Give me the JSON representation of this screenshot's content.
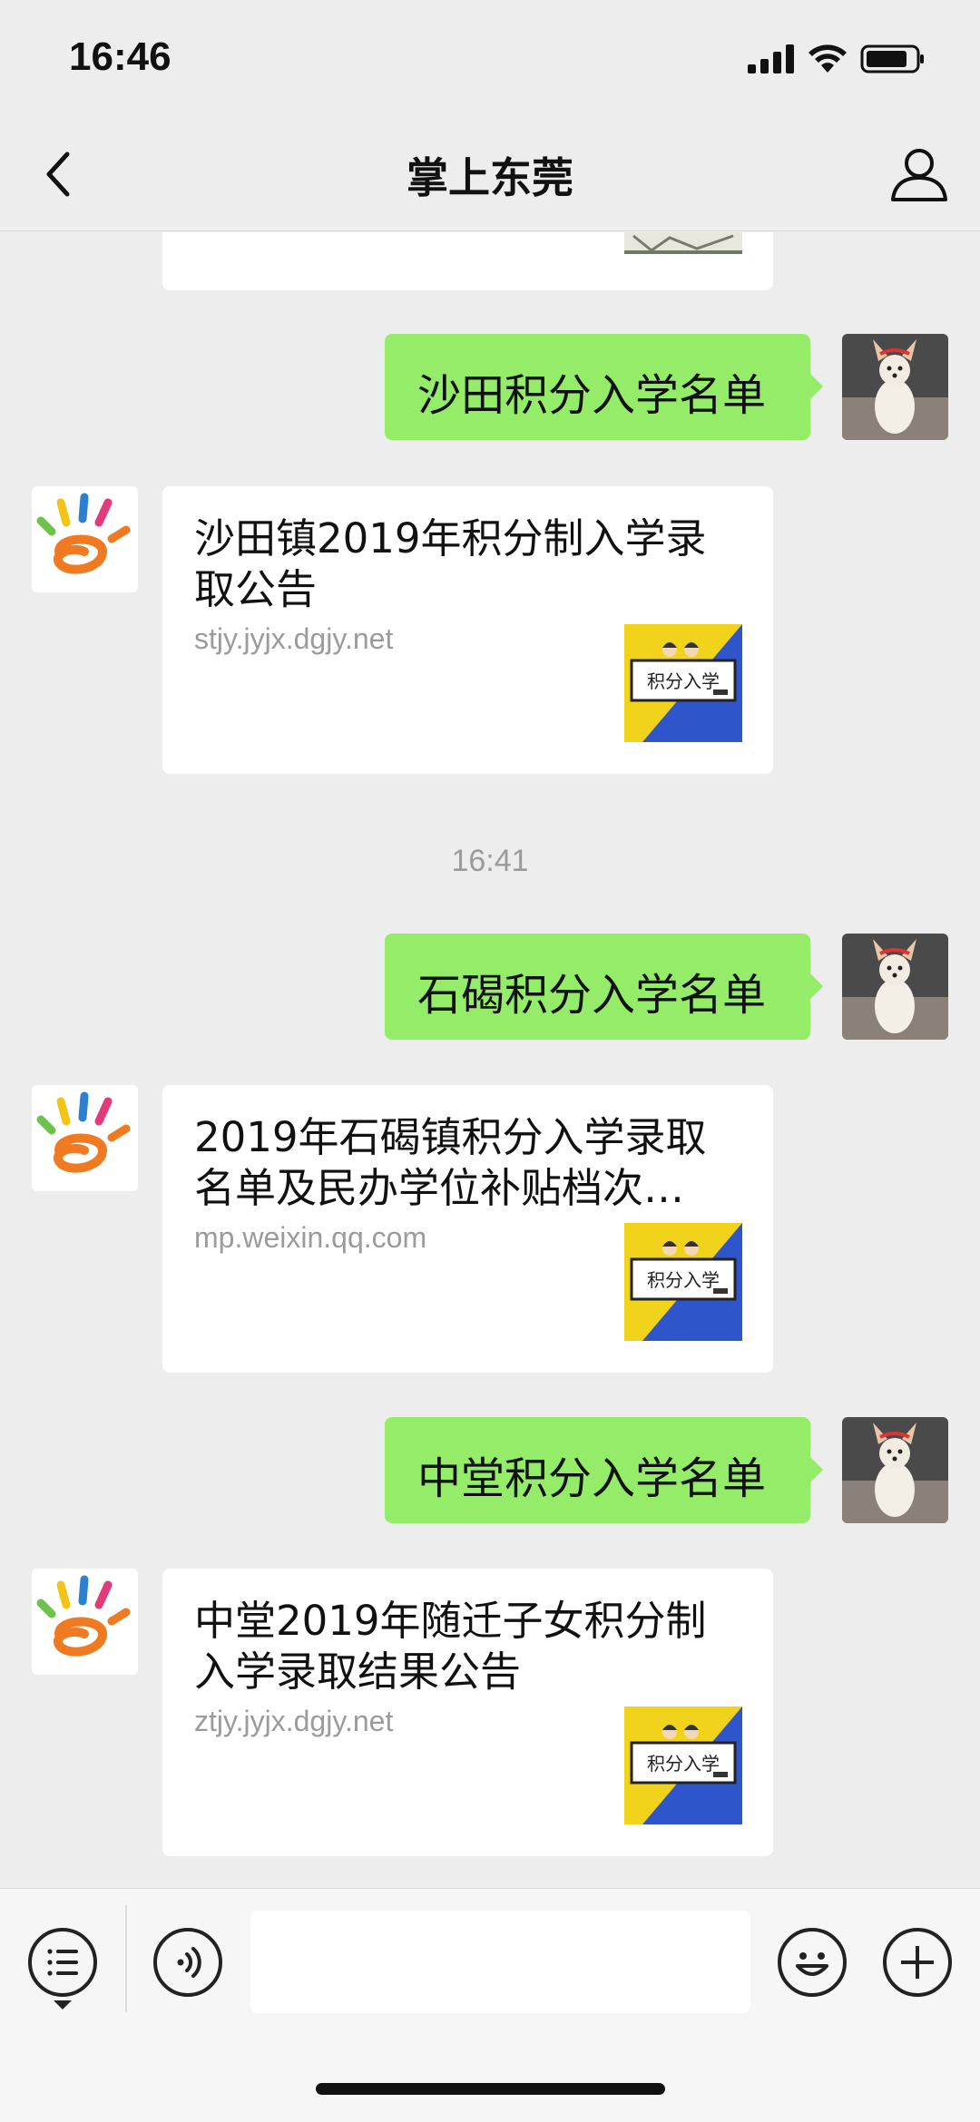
{
  "status": {
    "time": "16:46"
  },
  "nav": {
    "title": "掌上东莞",
    "back_icon": "chevron-left-icon",
    "profile_icon": "person-icon"
  },
  "messages": {
    "m1": {
      "text": "沙田积分入学名单"
    },
    "c1": {
      "title": "沙田镇2019年积分制入学录取公告",
      "url": "stjy.jyjx.dgjy.net",
      "thumb_text": "积分入学"
    },
    "ts": {
      "text": "16:41"
    },
    "m2": {
      "text": "石碣积分入学名单"
    },
    "c2": {
      "title": "2019年石碣镇积分入学录取名单及民办学位补贴档次…",
      "url": "mp.weixin.qq.com",
      "thumb_text": "积分入学"
    },
    "m3": {
      "text": "中堂积分入学名单"
    },
    "c3": {
      "title": "中堂2019年随迁子女积分制入学录取结果公告",
      "url": "ztjy.jyjx.dgjy.net",
      "thumb_text": "积分入学"
    }
  },
  "colors": {
    "bubble_out": "#95ec69",
    "background": "#ededed",
    "card": "#ffffff",
    "muted": "#9b9b9b"
  },
  "bottom": {
    "menu_icon": "list-menu-icon",
    "voice_icon": "voice-icon",
    "emoji_icon": "emoji-icon",
    "plus_icon": "plus-icon",
    "input_value": ""
  }
}
